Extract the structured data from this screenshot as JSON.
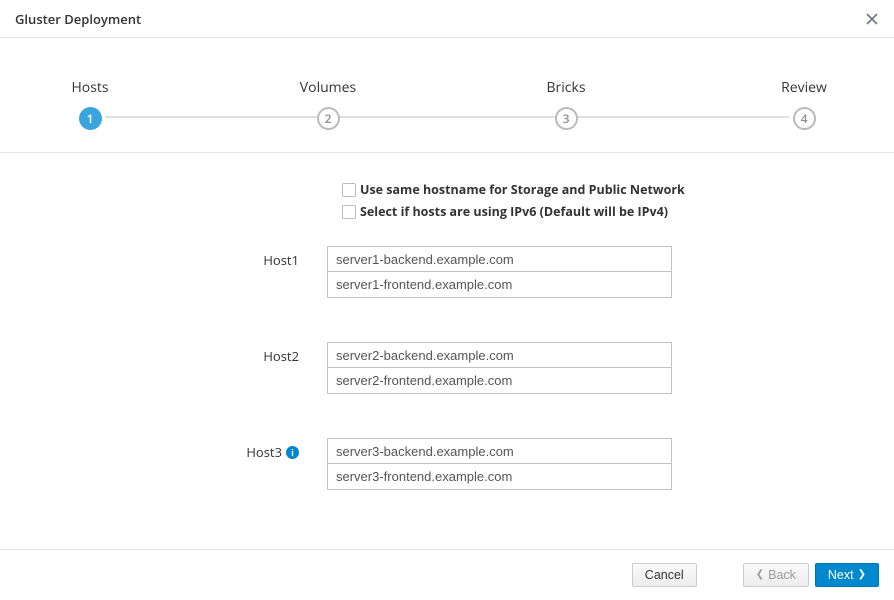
{
  "header": {
    "title": "Gluster Deployment"
  },
  "wizard": {
    "steps": [
      {
        "label": "Hosts",
        "num": "1",
        "state": "active"
      },
      {
        "label": "Volumes",
        "num": "2",
        "state": "pending"
      },
      {
        "label": "Bricks",
        "num": "3",
        "state": "pending"
      },
      {
        "label": "Review",
        "num": "4",
        "state": "pending"
      }
    ]
  },
  "form": {
    "checkboxes": {
      "same_hostname": "Use same hostname for Storage and Public Network",
      "ipv6": "Select if hosts are using IPv6 (Default will be IPv4)"
    },
    "hosts": [
      {
        "label": "Host1",
        "info": false,
        "backend": "server1-backend.example.com",
        "frontend": "server1-frontend.example.com"
      },
      {
        "label": "Host2",
        "info": false,
        "backend": "server2-backend.example.com",
        "frontend": "server2-frontend.example.com"
      },
      {
        "label": "Host3",
        "info": true,
        "backend": "server3-backend.example.com",
        "frontend": "server3-frontend.example.com"
      }
    ]
  },
  "footer": {
    "cancel": "Cancel",
    "back": "Back",
    "next": "Next"
  }
}
